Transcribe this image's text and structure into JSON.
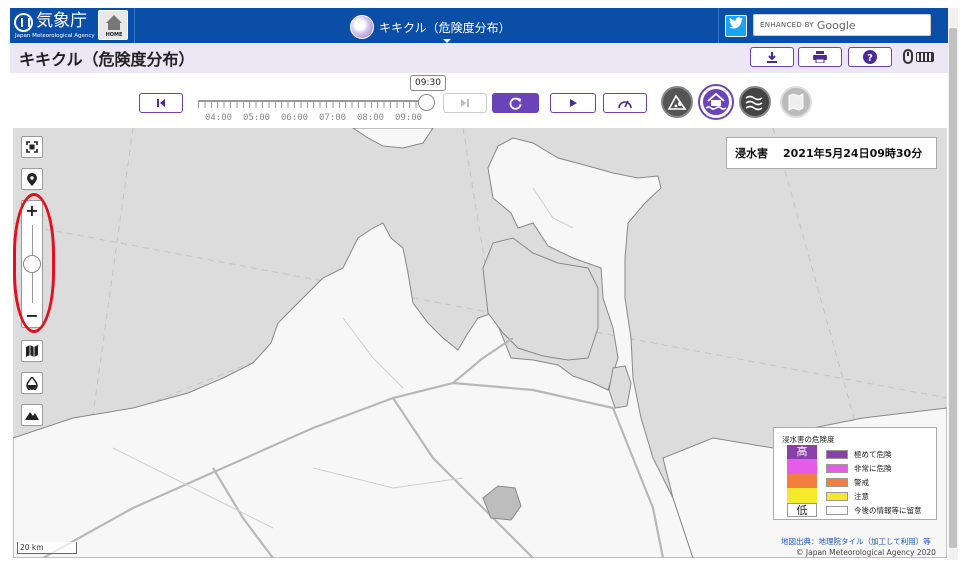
{
  "header": {
    "agency_name": "気象庁",
    "agency_english": "Japan Meteorological Agency",
    "home_label": "HOME",
    "center_title": "キキクル（危険度分布）",
    "search_label": "ENHANCED BY",
    "search_brand": "Google",
    "brand_color": "#0a4ea7"
  },
  "page": {
    "title": "キキクル（危険度分布）",
    "tools": [
      "download-icon",
      "print-icon",
      "help-icon"
    ]
  },
  "timeline": {
    "current_time": "09:30",
    "ticks": [
      "04:00",
      "05:00",
      "06:00",
      "07:00",
      "08:00",
      "09:00"
    ],
    "accent": "#6a44b8"
  },
  "layers": [
    "landslide-icon",
    "inundation-icon",
    "flood-icon",
    "map-layer-icon"
  ],
  "map": {
    "info_type": "浸水害",
    "info_time": "2021年5月24日09時30分",
    "scale": "20 km",
    "credit_source": "地図出典：地理院タイル（加工して利用）等",
    "copyright": "© Japan Meteorological Agency 2020",
    "zoom_in": "+",
    "zoom_out": "−"
  },
  "legend": {
    "title": "浸水害の危険度",
    "high": "高",
    "low": "低",
    "items": [
      {
        "label": "極めて危険",
        "color": "#8b3fa8"
      },
      {
        "label": "非常に危険",
        "color": "#e55ce8"
      },
      {
        "label": "警戒",
        "color": "#f27f3d"
      },
      {
        "label": "注意",
        "color": "#f4ea2b"
      },
      {
        "label": "今後の情報等に留意",
        "color": "#ffffff"
      }
    ]
  }
}
